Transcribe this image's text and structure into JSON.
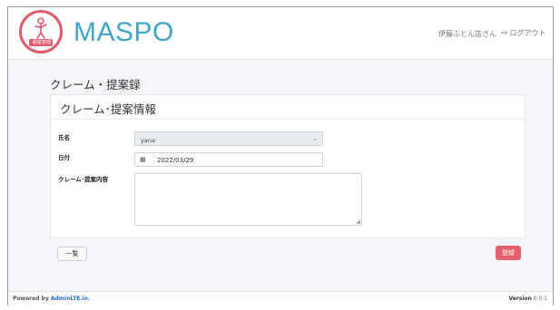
{
  "header": {
    "brand": "MASPO",
    "logo_text": "顧客管理",
    "user": "伊藤ふとん店さん",
    "logout": "ログアウト"
  },
  "page": {
    "title": "クレーム・提案録",
    "card_title": "クレーム･提案情報"
  },
  "form": {
    "name_label": "氏名",
    "name_value": "yana",
    "date_label": "日付",
    "date_value": "2022/03/29",
    "content_label": "クレーム･提案内容",
    "content_value": ""
  },
  "buttons": {
    "list": "一覧",
    "save": "登録"
  },
  "footer": {
    "powered_prefix": "Powered by",
    "powered_link": "AdminLTE.io.",
    "version_label": "Version",
    "version_value": "0.0.1"
  },
  "colors": {
    "brand": "#46a3c8",
    "accent": "#e05a6b",
    "save_button": "#e4606d"
  }
}
